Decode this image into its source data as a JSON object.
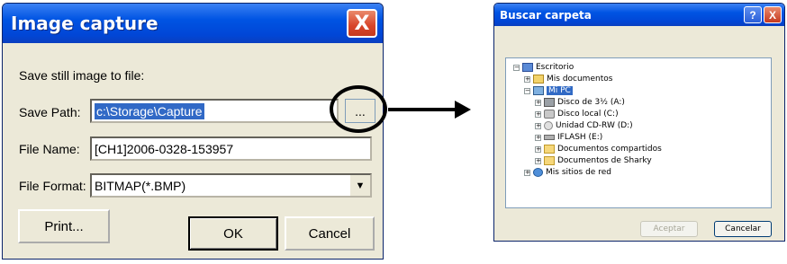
{
  "capture_dialog": {
    "title": "Image capture",
    "close_glyph": "X",
    "intro": "Save still image to file:",
    "save_path_label": "Save Path:",
    "save_path_value": "c:\\Storage\\Capture",
    "browse_label": "...",
    "file_name_label": "File Name:",
    "file_name_value": "[CH1]2006-0328-153957",
    "file_format_label": "File Format:",
    "file_format_value": "BITMAP(*.BMP)",
    "print_label": "Print...",
    "ok_label": "OK",
    "cancel_label": "Cancel"
  },
  "browse_dialog": {
    "title": "Buscar carpeta",
    "help_glyph": "?",
    "close_glyph": "X",
    "tree": [
      {
        "label": "Escritorio",
        "icon": "desktop-icon",
        "expander": "−"
      },
      {
        "label": "Mis documentos",
        "icon": "my-documents-icon",
        "expander": "+"
      },
      {
        "label": "Mi PC",
        "icon": "my-computer-icon",
        "expander": "−",
        "selected": true
      },
      {
        "label": "Disco de 3½ (A:)",
        "icon": "floppy-icon",
        "expander": "+"
      },
      {
        "label": "Disco local (C:)",
        "icon": "hard-disk-icon",
        "expander": "+"
      },
      {
        "label": "Unidad CD-RW (D:)",
        "icon": "cd-drive-icon",
        "expander": "+"
      },
      {
        "label": "IFLASH (E:)",
        "icon": "usb-drive-icon",
        "expander": "+"
      },
      {
        "label": "Documentos compartidos",
        "icon": "folder-icon",
        "expander": "+"
      },
      {
        "label": "Documentos de Sharky",
        "icon": "folder-icon",
        "expander": "+"
      },
      {
        "label": "Mis sitios de red",
        "icon": "network-icon",
        "expander": "+"
      }
    ],
    "accept_label": "Aceptar",
    "cancel_label": "Cancelar"
  }
}
